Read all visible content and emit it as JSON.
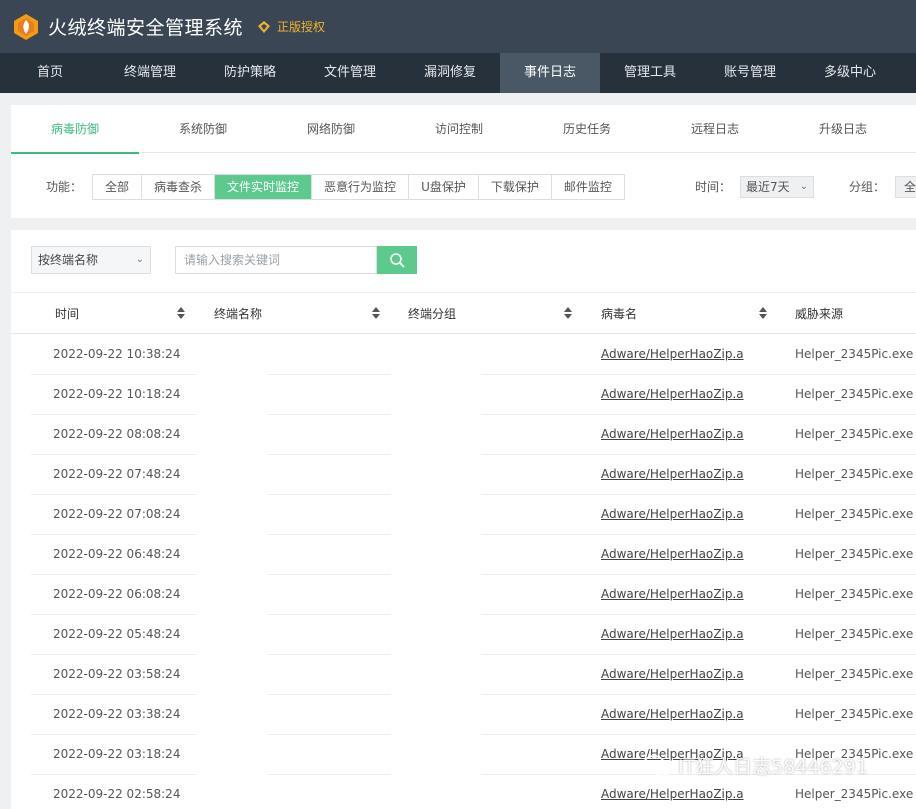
{
  "app": {
    "title": "火绒终端安全管理系统",
    "license": "正版授权",
    "colors": {
      "titlebar": "#3a4653",
      "nav": "#27313c",
      "accent": "#5cc98d",
      "license": "#f0b429"
    }
  },
  "nav": [
    {
      "label": "首页"
    },
    {
      "label": "终端管理"
    },
    {
      "label": "防护策略"
    },
    {
      "label": "文件管理"
    },
    {
      "label": "漏洞修复"
    },
    {
      "label": "事件日志",
      "active": true
    },
    {
      "label": "管理工具"
    },
    {
      "label": "账号管理"
    },
    {
      "label": "多级中心"
    }
  ],
  "subtabs": [
    {
      "label": "病毒防御",
      "active": true
    },
    {
      "label": "系统防御"
    },
    {
      "label": "网络防御"
    },
    {
      "label": "访问控制"
    },
    {
      "label": "历史任务"
    },
    {
      "label": "远程日志"
    },
    {
      "label": "升级日志"
    }
  ],
  "filters": {
    "function_label": "功能：",
    "functions": [
      {
        "label": "全部"
      },
      {
        "label": "病毒查杀"
      },
      {
        "label": "文件实时监控",
        "active": true
      },
      {
        "label": "恶意行为监控"
      },
      {
        "label": "U盘保护"
      },
      {
        "label": "下载保护"
      },
      {
        "label": "邮件监控"
      }
    ],
    "time_label": "时间：",
    "time_value": "最近7天",
    "group_label": "分组：",
    "group_value": "全"
  },
  "search": {
    "type_value": "按终端名称",
    "placeholder": "请输入搜索关键词"
  },
  "table": {
    "headers": [
      "时间",
      "终端名称",
      "终端分组",
      "病毒名",
      "威胁来源"
    ],
    "rows": [
      {
        "time": "2022-09-22 10:38:24",
        "terminal": "",
        "group": "",
        "virus": "Adware/HelperHaoZip.a",
        "source": "Helper_2345Pic.exe"
      },
      {
        "time": "2022-09-22 10:18:24",
        "terminal": "",
        "group": "",
        "virus": "Adware/HelperHaoZip.a",
        "source": "Helper_2345Pic.exe"
      },
      {
        "time": "2022-09-22 08:08:24",
        "terminal": "",
        "group": "",
        "virus": "Adware/HelperHaoZip.a",
        "source": "Helper_2345Pic.exe"
      },
      {
        "time": "2022-09-22 07:48:24",
        "terminal": "",
        "group": "",
        "virus": "Adware/HelperHaoZip.a",
        "source": "Helper_2345Pic.exe"
      },
      {
        "time": "2022-09-22 07:08:24",
        "terminal": "",
        "group": "",
        "virus": "Adware/HelperHaoZip.a",
        "source": "Helper_2345Pic.exe"
      },
      {
        "time": "2022-09-22 06:48:24",
        "terminal": "",
        "group": "",
        "virus": "Adware/HelperHaoZip.a",
        "source": "Helper_2345Pic.exe"
      },
      {
        "time": "2022-09-22 06:08:24",
        "terminal": "",
        "group": "",
        "virus": "Adware/HelperHaoZip.a",
        "source": "Helper_2345Pic.exe"
      },
      {
        "time": "2022-09-22 05:48:24",
        "terminal": "",
        "group": "",
        "virus": "Adware/HelperHaoZip.a",
        "source": "Helper_2345Pic.exe"
      },
      {
        "time": "2022-09-22 03:58:24",
        "terminal": "",
        "group": "",
        "virus": "Adware/HelperHaoZip.a",
        "source": "Helper_2345Pic.exe"
      },
      {
        "time": "2022-09-22 03:38:24",
        "terminal": "",
        "group": "",
        "virus": "Adware/HelperHaoZip.a",
        "source": "Helper_2345Pic.exe"
      },
      {
        "time": "2022-09-22 03:18:24",
        "terminal": "",
        "group": "",
        "virus": "Adware/HelperHaoZip.a",
        "source": "Helper_2345Pic.exe"
      },
      {
        "time": "2022-09-22 02:58:24",
        "terminal": "",
        "group": "",
        "virus": "Adware/HelperHaoZip.a",
        "source": "Helper_2345Pic.exe"
      }
    ]
  },
  "watermark": "IT狂人日志58446291"
}
